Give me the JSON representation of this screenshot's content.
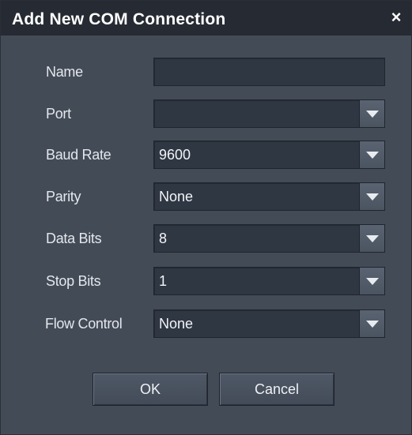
{
  "dialog": {
    "title": "Add New COM Connection",
    "close_label": "×"
  },
  "fields": {
    "name": {
      "label": "Name",
      "value": ""
    },
    "port": {
      "label": "Port",
      "value": ""
    },
    "baud_rate": {
      "label": "Baud Rate",
      "value": "9600"
    },
    "parity": {
      "label": "Parity",
      "value": "None"
    },
    "data_bits": {
      "label": "Data Bits",
      "value": "8"
    },
    "stop_bits": {
      "label": "Stop Bits",
      "value": "1"
    },
    "flow_control": {
      "label": "Flow Control",
      "value": "None"
    }
  },
  "buttons": {
    "ok": "OK",
    "cancel": "Cancel"
  },
  "colors": {
    "background": "#434b57",
    "titlebar": "#262b33",
    "field": "#2f3743",
    "text": "#f2f4f7"
  }
}
